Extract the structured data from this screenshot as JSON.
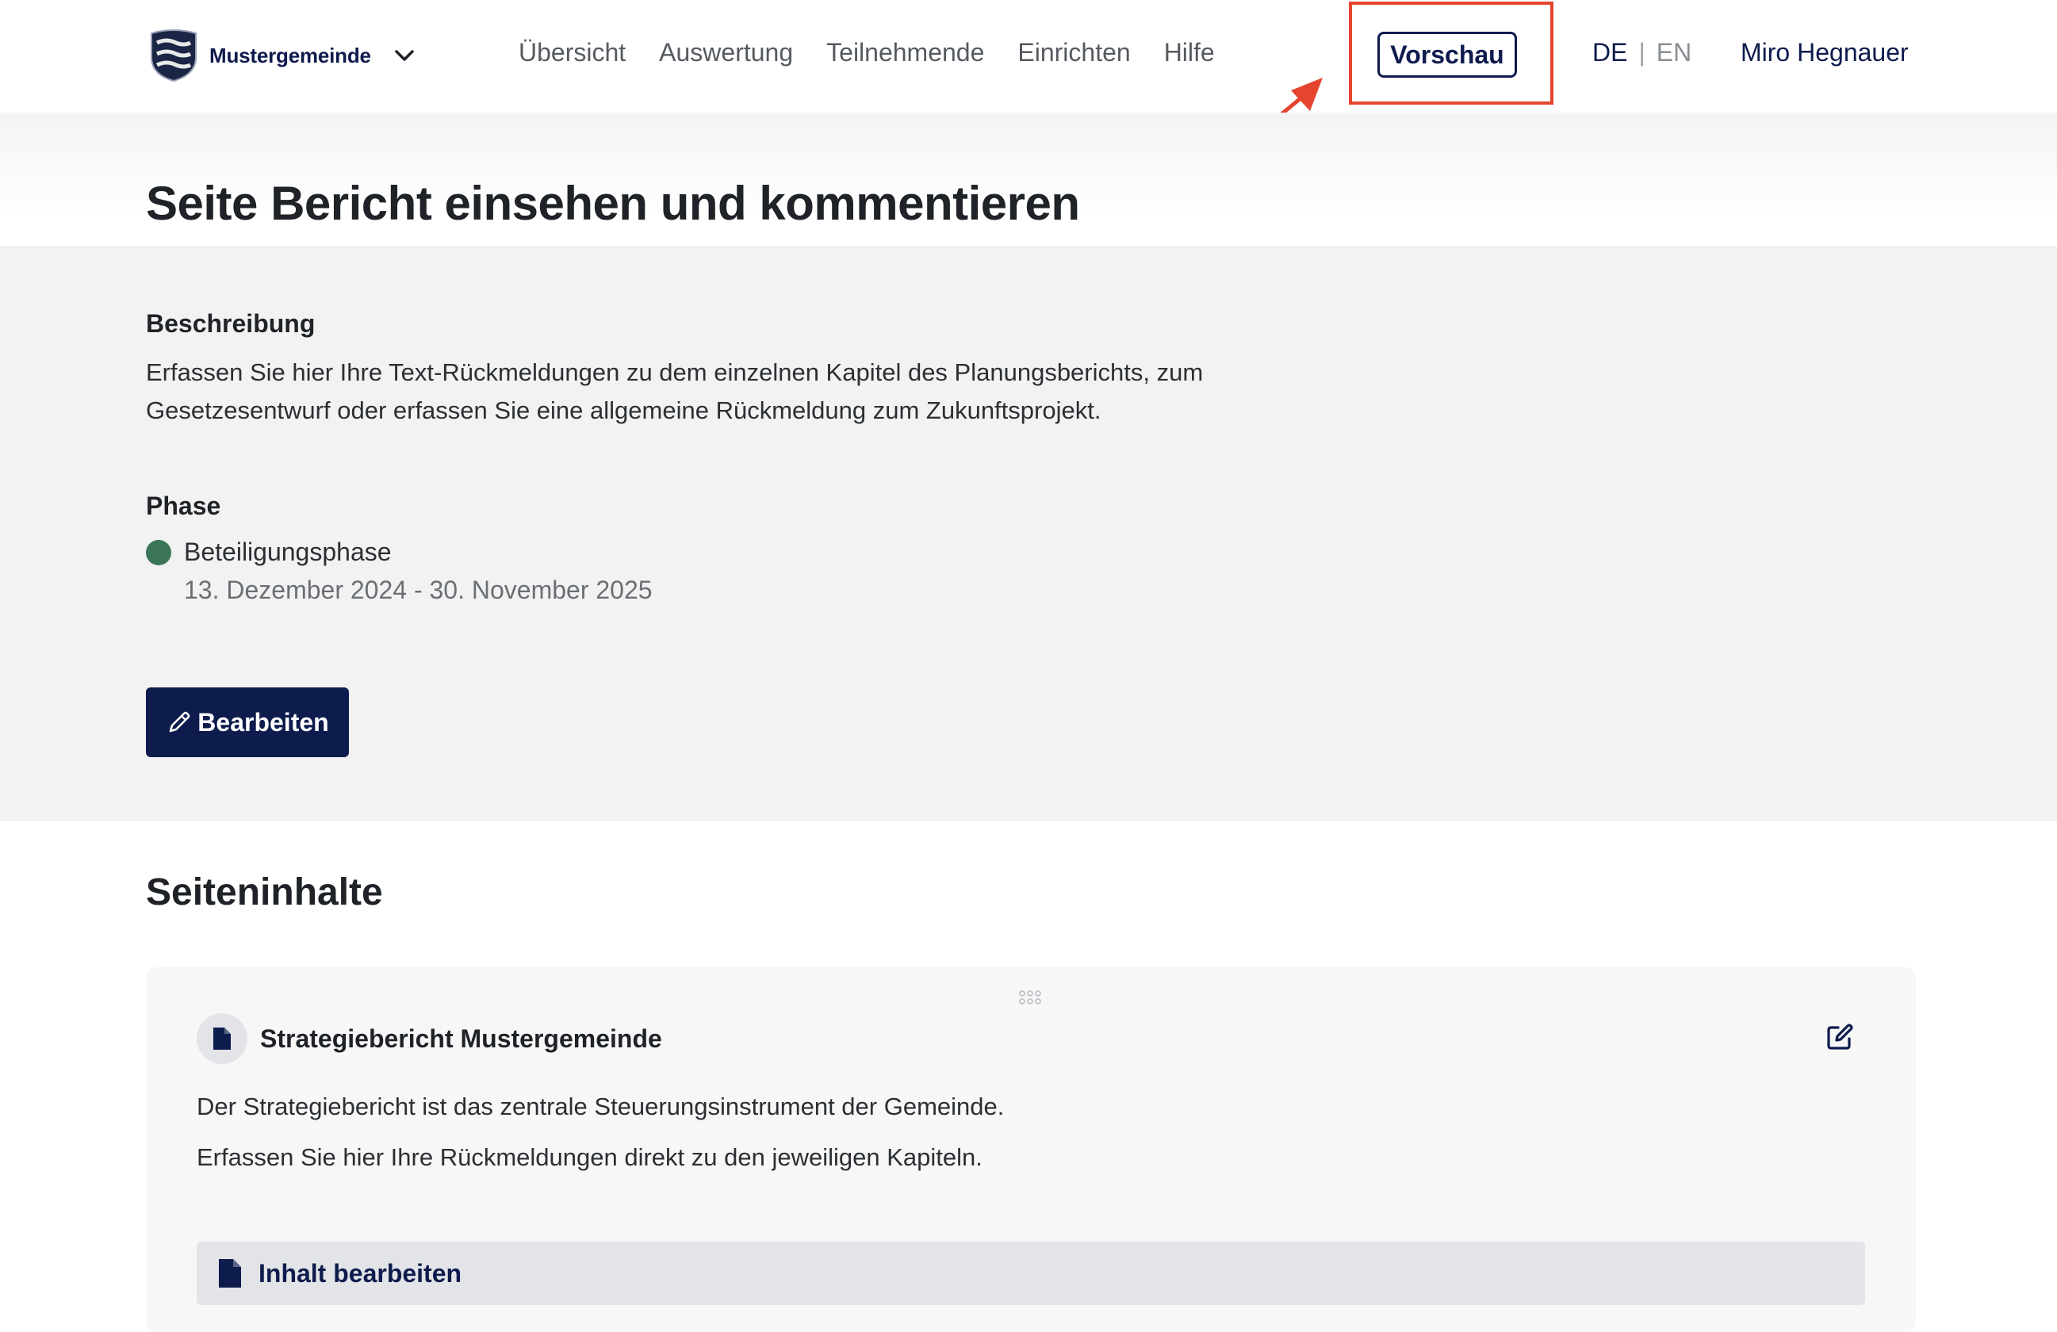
{
  "header": {
    "brand": "Mustergemeinde",
    "nav": [
      "Übersicht",
      "Auswertung",
      "Teilnehmende",
      "Einrichten",
      "Hilfe"
    ],
    "preview_label": "Vorschau",
    "lang_de": "DE",
    "lang_sep": "|",
    "lang_en": "EN",
    "user": "Miro Hegnauer"
  },
  "page": {
    "title": "Seite Bericht einsehen und kommentieren"
  },
  "info": {
    "description_label": "Beschreibung",
    "description_line1": "Erfassen Sie hier Ihre Text-Rückmeldungen zu dem einzelnen Kapitel des Planungsberichts, zum",
    "description_line2": "Gesetzesentwurf oder erfassen Sie eine allgemeine Rückmeldung zum Zukunftsprojekt.",
    "phase_label": "Phase",
    "phase_name": "Beteiligungsphase",
    "phase_dates": "13. Dezember 2024 - 30. November 2025",
    "phase_color": "#3b7557",
    "edit_label": "Bearbeiten"
  },
  "contents": {
    "section_title": "Seiteninhalte",
    "card": {
      "title": "Strategiebericht Mustergemeinde",
      "paragraph1": "Der Strategiebericht ist das zentrale Steuerungsinstrument der Gemeinde.",
      "paragraph2": "Erfassen Sie hier Ihre Rückmeldungen direkt zu den jeweiligen Kapiteln.",
      "edit_content_label": "Inhalt bearbeiten"
    }
  },
  "colors": {
    "primary": "#0e1b4d",
    "highlight": "#e5452f",
    "panel_bg": "#f2f2f2"
  }
}
